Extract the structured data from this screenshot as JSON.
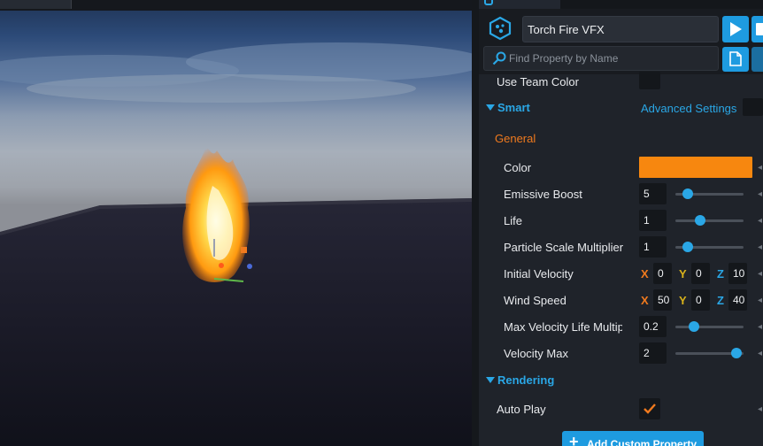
{
  "object": {
    "name": "Torch Fire VFX"
  },
  "search": {
    "placeholder": "Find Property by Name"
  },
  "colors": {
    "accent": "#2aa7e6",
    "orange": "#f7870f",
    "section_general": "#f07a1e"
  },
  "properties": {
    "use_team_color": {
      "label": "Use Team Color"
    },
    "smart": {
      "title": "Smart",
      "advanced_settings": "Advanced Settings",
      "general_title": "General",
      "color": {
        "label": "Color",
        "value": "#f7870f"
      },
      "emissive_boost": {
        "label": "Emissive Boost",
        "value": "5",
        "slider_fraction": 0.18
      },
      "life": {
        "label": "Life",
        "value": "1",
        "slider_fraction": 0.36
      },
      "particle_scale": {
        "label": "Particle Scale Multiplier",
        "value": "1",
        "slider_fraction": 0.18
      },
      "initial_velocity": {
        "label": "Initial Velocity",
        "x_label": "X",
        "y_label": "Y",
        "z_label": "Z",
        "x": "0",
        "y": "0",
        "z": "10"
      },
      "wind_speed": {
        "label": "Wind Speed",
        "x_label": "X",
        "y_label": "Y",
        "z_label": "Z",
        "x": "50",
        "y": "0",
        "z": "40"
      },
      "max_velocity_life": {
        "label": "Max Velocity Life Multip",
        "value": "0.2",
        "slider_fraction": 0.27
      },
      "velocity_max": {
        "label": "Velocity Max",
        "value": "2",
        "slider_fraction": 0.9
      }
    },
    "rendering": {
      "title": "Rendering",
      "auto_play": {
        "label": "Auto Play",
        "checked": true
      }
    }
  },
  "buttons": {
    "add_custom_property": "Add Custom Property"
  },
  "icons": {
    "object": "vfx-hexagon-icon",
    "play": "play-icon",
    "stop": "stop-icon",
    "search": "magnifier-icon",
    "doc": "document-icon",
    "check": "checkmark-icon",
    "plus": "plus-icon"
  }
}
